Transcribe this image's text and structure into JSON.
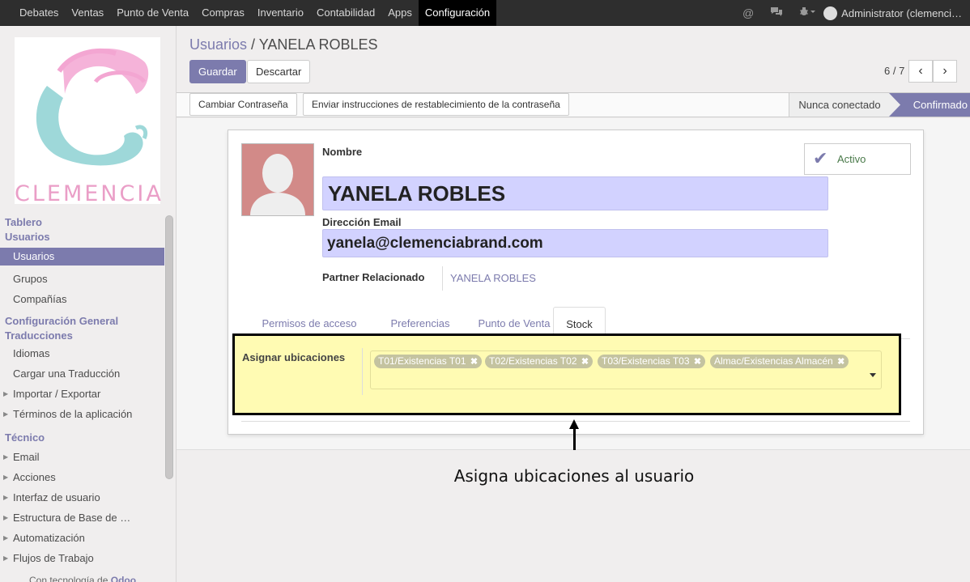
{
  "topbar": {
    "menu": [
      "Debates",
      "Ventas",
      "Punto de Venta",
      "Compras",
      "Inventario",
      "Contabilidad",
      "Apps",
      "Configuración"
    ],
    "active": "Configuración",
    "user": "Administrator (clemenci…"
  },
  "logo": {
    "text": "CLEMENCIA"
  },
  "sidebar": {
    "sections": [
      {
        "head": "Tablero"
      },
      {
        "head": "Usuarios",
        "items": [
          {
            "label": "Usuarios",
            "active": true
          },
          {
            "label": "Grupos"
          },
          {
            "label": "Compañías"
          }
        ]
      },
      {
        "head": "Configuración General"
      },
      {
        "head": "Traducciones",
        "items": [
          {
            "label": "Idiomas"
          },
          {
            "label": "Cargar una Traducción"
          },
          {
            "label": "Importar / Exportar",
            "caret": true
          },
          {
            "label": "Términos de la aplicación",
            "caret": true
          }
        ]
      },
      {
        "head": "Técnico",
        "items": [
          {
            "label": "Email",
            "caret": true
          },
          {
            "label": "Acciones",
            "caret": true
          },
          {
            "label": "Interfaz de usuario",
            "caret": true
          },
          {
            "label": "Estructura de Base de …",
            "caret": true
          },
          {
            "label": "Automatización",
            "caret": true
          },
          {
            "label": "Flujos de Trabajo",
            "caret": true
          }
        ]
      }
    ],
    "powered_prefix": "Con tecnología de",
    "powered_brand": "Odoo"
  },
  "breadcrumb": {
    "parent": "Usuarios",
    "sep": "/",
    "current": "YANELA ROBLES"
  },
  "buttons": {
    "save": "Guardar",
    "discard": "Descartar"
  },
  "pager": {
    "text": "6 / 7",
    "prev": "‹",
    "next": "›"
  },
  "statusbar": {
    "change_password": "Cambiar Contraseña",
    "send_reset": "Enviar instrucciones de restablecimiento de la contraseña",
    "stages": [
      "Nunca conectado",
      "Confirmado"
    ],
    "current_stage": "Confirmado"
  },
  "form": {
    "name_label": "Nombre",
    "name_value": "YANELA ROBLES",
    "email_label": "Dirección Email",
    "email_value": "yanela@clemenciabrand.com",
    "partner_label": "Partner Relacionado",
    "partner_value": "YANELA ROBLES",
    "active_label": "Activo"
  },
  "tabs": [
    {
      "label": "Permisos de acceso"
    },
    {
      "label": "Preferencias"
    },
    {
      "label": "Punto de Venta"
    },
    {
      "label": "Stock",
      "active": true
    }
  ],
  "stock_tab": {
    "field_label": "Asignar ubicaciones",
    "tags": [
      "T01/Existencias T01",
      "T02/Existencias T02",
      "T03/Existencias T03",
      "Almac/Existencias Almacén"
    ],
    "remove_symbol": "✖"
  },
  "annotation": "Asigna ubicaciones al usuario",
  "colors": {
    "accent": "#7c7bad",
    "highlight": "#fffbb3",
    "field": "#d2d2ff"
  }
}
